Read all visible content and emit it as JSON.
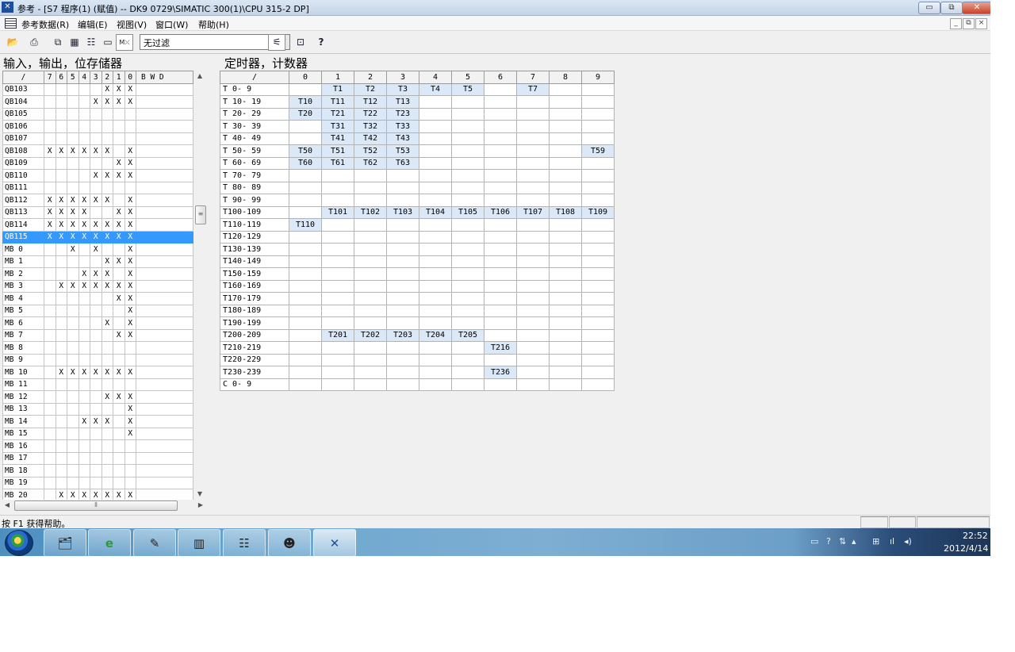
{
  "window": {
    "title": "参考 - [S7 程序(1) (赋值) -- DK9 0729\\SIMATIC 300(1)\\CPU 315-2 DP]",
    "minimize": "▭",
    "restore": "⧉",
    "close": "✕",
    "mdi_min": "_",
    "mdi_restore": "⧉",
    "mdi_close": "×"
  },
  "menu": [
    "参考数据(R)",
    "编辑(E)",
    "视图(V)",
    "窗口(W)",
    "帮助(H)"
  ],
  "toolbar": {
    "filter_value": "无过滤",
    "icons": [
      "open-icon",
      "print-icon",
      "cross-ref-icon",
      "assignment-icon",
      "structure-icon",
      "unused-icon",
      "address-no-symbol-icon",
      "filter-icon",
      "new-window-icon",
      "help-icon"
    ]
  },
  "left_panel": {
    "title": "输入，输出，位存储器",
    "headers": [
      "/",
      "7",
      "6",
      "5",
      "4",
      "3",
      "2",
      "1",
      "0",
      "B",
      "W",
      "D"
    ],
    "selected_row": "QB115",
    "rows": [
      {
        "addr": "QB103",
        "bits": [
          "",
          "",
          "",
          "",
          "",
          "X",
          "X",
          "X"
        ]
      },
      {
        "addr": "QB104",
        "bits": [
          "",
          "",
          "",
          "",
          "X",
          "X",
          "X",
          "X"
        ]
      },
      {
        "addr": "QB105",
        "bits": [
          "",
          "",
          "",
          "",
          "",
          "",
          "",
          ""
        ]
      },
      {
        "addr": "QB106",
        "bits": [
          "",
          "",
          "",
          "",
          "",
          "",
          "",
          ""
        ]
      },
      {
        "addr": "QB107",
        "bits": [
          "",
          "",
          "",
          "",
          "",
          "",
          "",
          ""
        ]
      },
      {
        "addr": "QB108",
        "bits": [
          "X",
          "X",
          "X",
          "X",
          "X",
          "X",
          "",
          "X"
        ]
      },
      {
        "addr": "QB109",
        "bits": [
          "",
          "",
          "",
          "",
          "",
          "",
          "X",
          "X"
        ]
      },
      {
        "addr": "QB110",
        "bits": [
          "",
          "",
          "",
          "",
          "X",
          "X",
          "X",
          "X"
        ]
      },
      {
        "addr": "QB111",
        "bits": [
          "",
          "",
          "",
          "",
          "",
          "",
          "",
          ""
        ]
      },
      {
        "addr": "QB112",
        "bits": [
          "X",
          "X",
          "X",
          "X",
          "X",
          "X",
          "",
          "X"
        ]
      },
      {
        "addr": "QB113",
        "bits": [
          "X",
          "X",
          "X",
          "X",
          "",
          "",
          "X",
          "X"
        ]
      },
      {
        "addr": "QB114",
        "bits": [
          "X",
          "X",
          "X",
          "X",
          "X",
          "X",
          "X",
          "X"
        ]
      },
      {
        "addr": "QB115",
        "bits": [
          "X",
          "X",
          "X",
          "X",
          "X",
          "X",
          "X",
          "X"
        ]
      },
      {
        "addr": "MB  0",
        "bits": [
          "",
          "",
          "X",
          "",
          "X",
          "",
          "",
          "X"
        ]
      },
      {
        "addr": "MB  1",
        "bits": [
          "",
          "",
          "",
          "",
          "",
          "X",
          "X",
          "X"
        ]
      },
      {
        "addr": "MB  2",
        "bits": [
          "",
          "",
          "",
          "X",
          "X",
          "X",
          "",
          "X"
        ]
      },
      {
        "addr": "MB  3",
        "bits": [
          "",
          "X",
          "X",
          "X",
          "X",
          "X",
          "X",
          "X"
        ]
      },
      {
        "addr": "MB  4",
        "bits": [
          "",
          "",
          "",
          "",
          "",
          "",
          "X",
          "X"
        ]
      },
      {
        "addr": "MB  5",
        "bits": [
          "",
          "",
          "",
          "",
          "",
          "",
          "",
          "X"
        ]
      },
      {
        "addr": "MB  6",
        "bits": [
          "",
          "",
          "",
          "",
          "",
          "X",
          "",
          "X"
        ]
      },
      {
        "addr": "MB  7",
        "bits": [
          "",
          "",
          "",
          "",
          "",
          "",
          "X",
          "X"
        ]
      },
      {
        "addr": "MB  8",
        "bits": [
          "",
          "",
          "",
          "",
          "",
          "",
          "",
          ""
        ]
      },
      {
        "addr": "MB  9",
        "bits": [
          "",
          "",
          "",
          "",
          "",
          "",
          "",
          ""
        ]
      },
      {
        "addr": "MB 10",
        "bits": [
          "",
          "X",
          "X",
          "X",
          "X",
          "X",
          "X",
          "X"
        ]
      },
      {
        "addr": "MB 11",
        "bits": [
          "",
          "",
          "",
          "",
          "",
          "",
          "",
          ""
        ]
      },
      {
        "addr": "MB 12",
        "bits": [
          "",
          "",
          "",
          "",
          "",
          "X",
          "X",
          "X"
        ]
      },
      {
        "addr": "MB 13",
        "bits": [
          "",
          "",
          "",
          "",
          "",
          "",
          "",
          "X"
        ]
      },
      {
        "addr": "MB 14",
        "bits": [
          "",
          "",
          "",
          "X",
          "X",
          "X",
          "",
          "X"
        ]
      },
      {
        "addr": "MB 15",
        "bits": [
          "",
          "",
          "",
          "",
          "",
          "",
          "",
          "X"
        ]
      },
      {
        "addr": "MB 16",
        "bits": [
          "",
          "",
          "",
          "",
          "",
          "",
          "",
          ""
        ]
      },
      {
        "addr": "MB 17",
        "bits": [
          "",
          "",
          "",
          "",
          "",
          "",
          "",
          ""
        ]
      },
      {
        "addr": "MB 18",
        "bits": [
          "",
          "",
          "",
          "",
          "",
          "",
          "",
          ""
        ]
      },
      {
        "addr": "MB 19",
        "bits": [
          "",
          "",
          "",
          "",
          "",
          "",
          "",
          ""
        ]
      },
      {
        "addr": "MB 20",
        "bits": [
          "",
          "X",
          "X",
          "X",
          "X",
          "X",
          "X",
          "X"
        ]
      }
    ]
  },
  "right_panel": {
    "title": "定时器，计数器",
    "headers": [
      "/",
      "0",
      "1",
      "2",
      "3",
      "4",
      "5",
      "6",
      "7",
      "8",
      "9"
    ],
    "rows": [
      {
        "range": "T  0-  9",
        "cells": [
          "",
          "T1",
          "T2",
          "T3",
          "T4",
          "T5",
          "",
          "T7",
          "",
          ""
        ]
      },
      {
        "range": "T 10- 19",
        "cells": [
          "T10",
          "T11",
          "T12",
          "T13",
          "",
          "",
          "",
          "",
          "",
          ""
        ]
      },
      {
        "range": "T 20- 29",
        "cells": [
          "T20",
          "T21",
          "T22",
          "T23",
          "",
          "",
          "",
          "",
          "",
          ""
        ]
      },
      {
        "range": "T 30- 39",
        "cells": [
          "",
          "T31",
          "T32",
          "T33",
          "",
          "",
          "",
          "",
          "",
          ""
        ]
      },
      {
        "range": "T 40- 49",
        "cells": [
          "",
          "T41",
          "T42",
          "T43",
          "",
          "",
          "",
          "",
          "",
          ""
        ]
      },
      {
        "range": "T 50- 59",
        "cells": [
          "T50",
          "T51",
          "T52",
          "T53",
          "",
          "",
          "",
          "",
          "",
          "T59"
        ]
      },
      {
        "range": "T 60- 69",
        "cells": [
          "T60",
          "T61",
          "T62",
          "T63",
          "",
          "",
          "",
          "",
          "",
          ""
        ]
      },
      {
        "range": "T 70- 79",
        "cells": [
          "",
          "",
          "",
          "",
          "",
          "",
          "",
          "",
          "",
          ""
        ]
      },
      {
        "range": "T 80- 89",
        "cells": [
          "",
          "",
          "",
          "",
          "",
          "",
          "",
          "",
          "",
          ""
        ]
      },
      {
        "range": "T 90- 99",
        "cells": [
          "",
          "",
          "",
          "",
          "",
          "",
          "",
          "",
          "",
          ""
        ]
      },
      {
        "range": "T100-109",
        "cells": [
          "",
          "T101",
          "T102",
          "T103",
          "T104",
          "T105",
          "T106",
          "T107",
          "T108",
          "T109"
        ]
      },
      {
        "range": "T110-119",
        "cells": [
          "T110",
          "",
          "",
          "",
          "",
          "",
          "",
          "",
          "",
          ""
        ]
      },
      {
        "range": "T120-129",
        "cells": [
          "",
          "",
          "",
          "",
          "",
          "",
          "",
          "",
          "",
          ""
        ]
      },
      {
        "range": "T130-139",
        "cells": [
          "",
          "",
          "",
          "",
          "",
          "",
          "",
          "",
          "",
          ""
        ]
      },
      {
        "range": "T140-149",
        "cells": [
          "",
          "",
          "",
          "",
          "",
          "",
          "",
          "",
          "",
          ""
        ]
      },
      {
        "range": "T150-159",
        "cells": [
          "",
          "",
          "",
          "",
          "",
          "",
          "",
          "",
          "",
          ""
        ]
      },
      {
        "range": "T160-169",
        "cells": [
          "",
          "",
          "",
          "",
          "",
          "",
          "",
          "",
          "",
          ""
        ]
      },
      {
        "range": "T170-179",
        "cells": [
          "",
          "",
          "",
          "",
          "",
          "",
          "",
          "",
          "",
          ""
        ]
      },
      {
        "range": "T180-189",
        "cells": [
          "",
          "",
          "",
          "",
          "",
          "",
          "",
          "",
          "",
          ""
        ]
      },
      {
        "range": "T190-199",
        "cells": [
          "",
          "",
          "",
          "",
          "",
          "",
          "",
          "",
          "",
          ""
        ]
      },
      {
        "range": "T200-209",
        "cells": [
          "",
          "T201",
          "T202",
          "T203",
          "T204",
          "T205",
          "",
          "",
          "",
          ""
        ]
      },
      {
        "range": "T210-219",
        "cells": [
          "",
          "",
          "",
          "",
          "",
          "",
          "T216",
          "",
          "",
          ""
        ]
      },
      {
        "range": "T220-229",
        "cells": [
          "",
          "",
          "",
          "",
          "",
          "",
          "",
          "",
          "",
          ""
        ]
      },
      {
        "range": "T230-239",
        "cells": [
          "",
          "",
          "",
          "",
          "",
          "",
          "T236",
          "",
          "",
          ""
        ]
      },
      {
        "range": "C  0-  9",
        "cells": [
          "",
          "",
          "",
          "",
          "",
          "",
          "",
          "",
          "",
          ""
        ]
      }
    ]
  },
  "status": {
    "help_text": "按 F1 获得帮助。"
  },
  "taskbar": {
    "start_icon": "windows-start-icon",
    "tasks": [
      "explorer-icon",
      "ie-icon",
      "simatic-manager-icon",
      "hw-config-icon",
      "ladder-editor-icon",
      "qq-icon",
      "reference-data-icon"
    ],
    "time": "22:52",
    "date": "2012/4/14"
  },
  "colors": {
    "selection": "#3399ff",
    "used_timer_cell": "#dbe8f7"
  }
}
